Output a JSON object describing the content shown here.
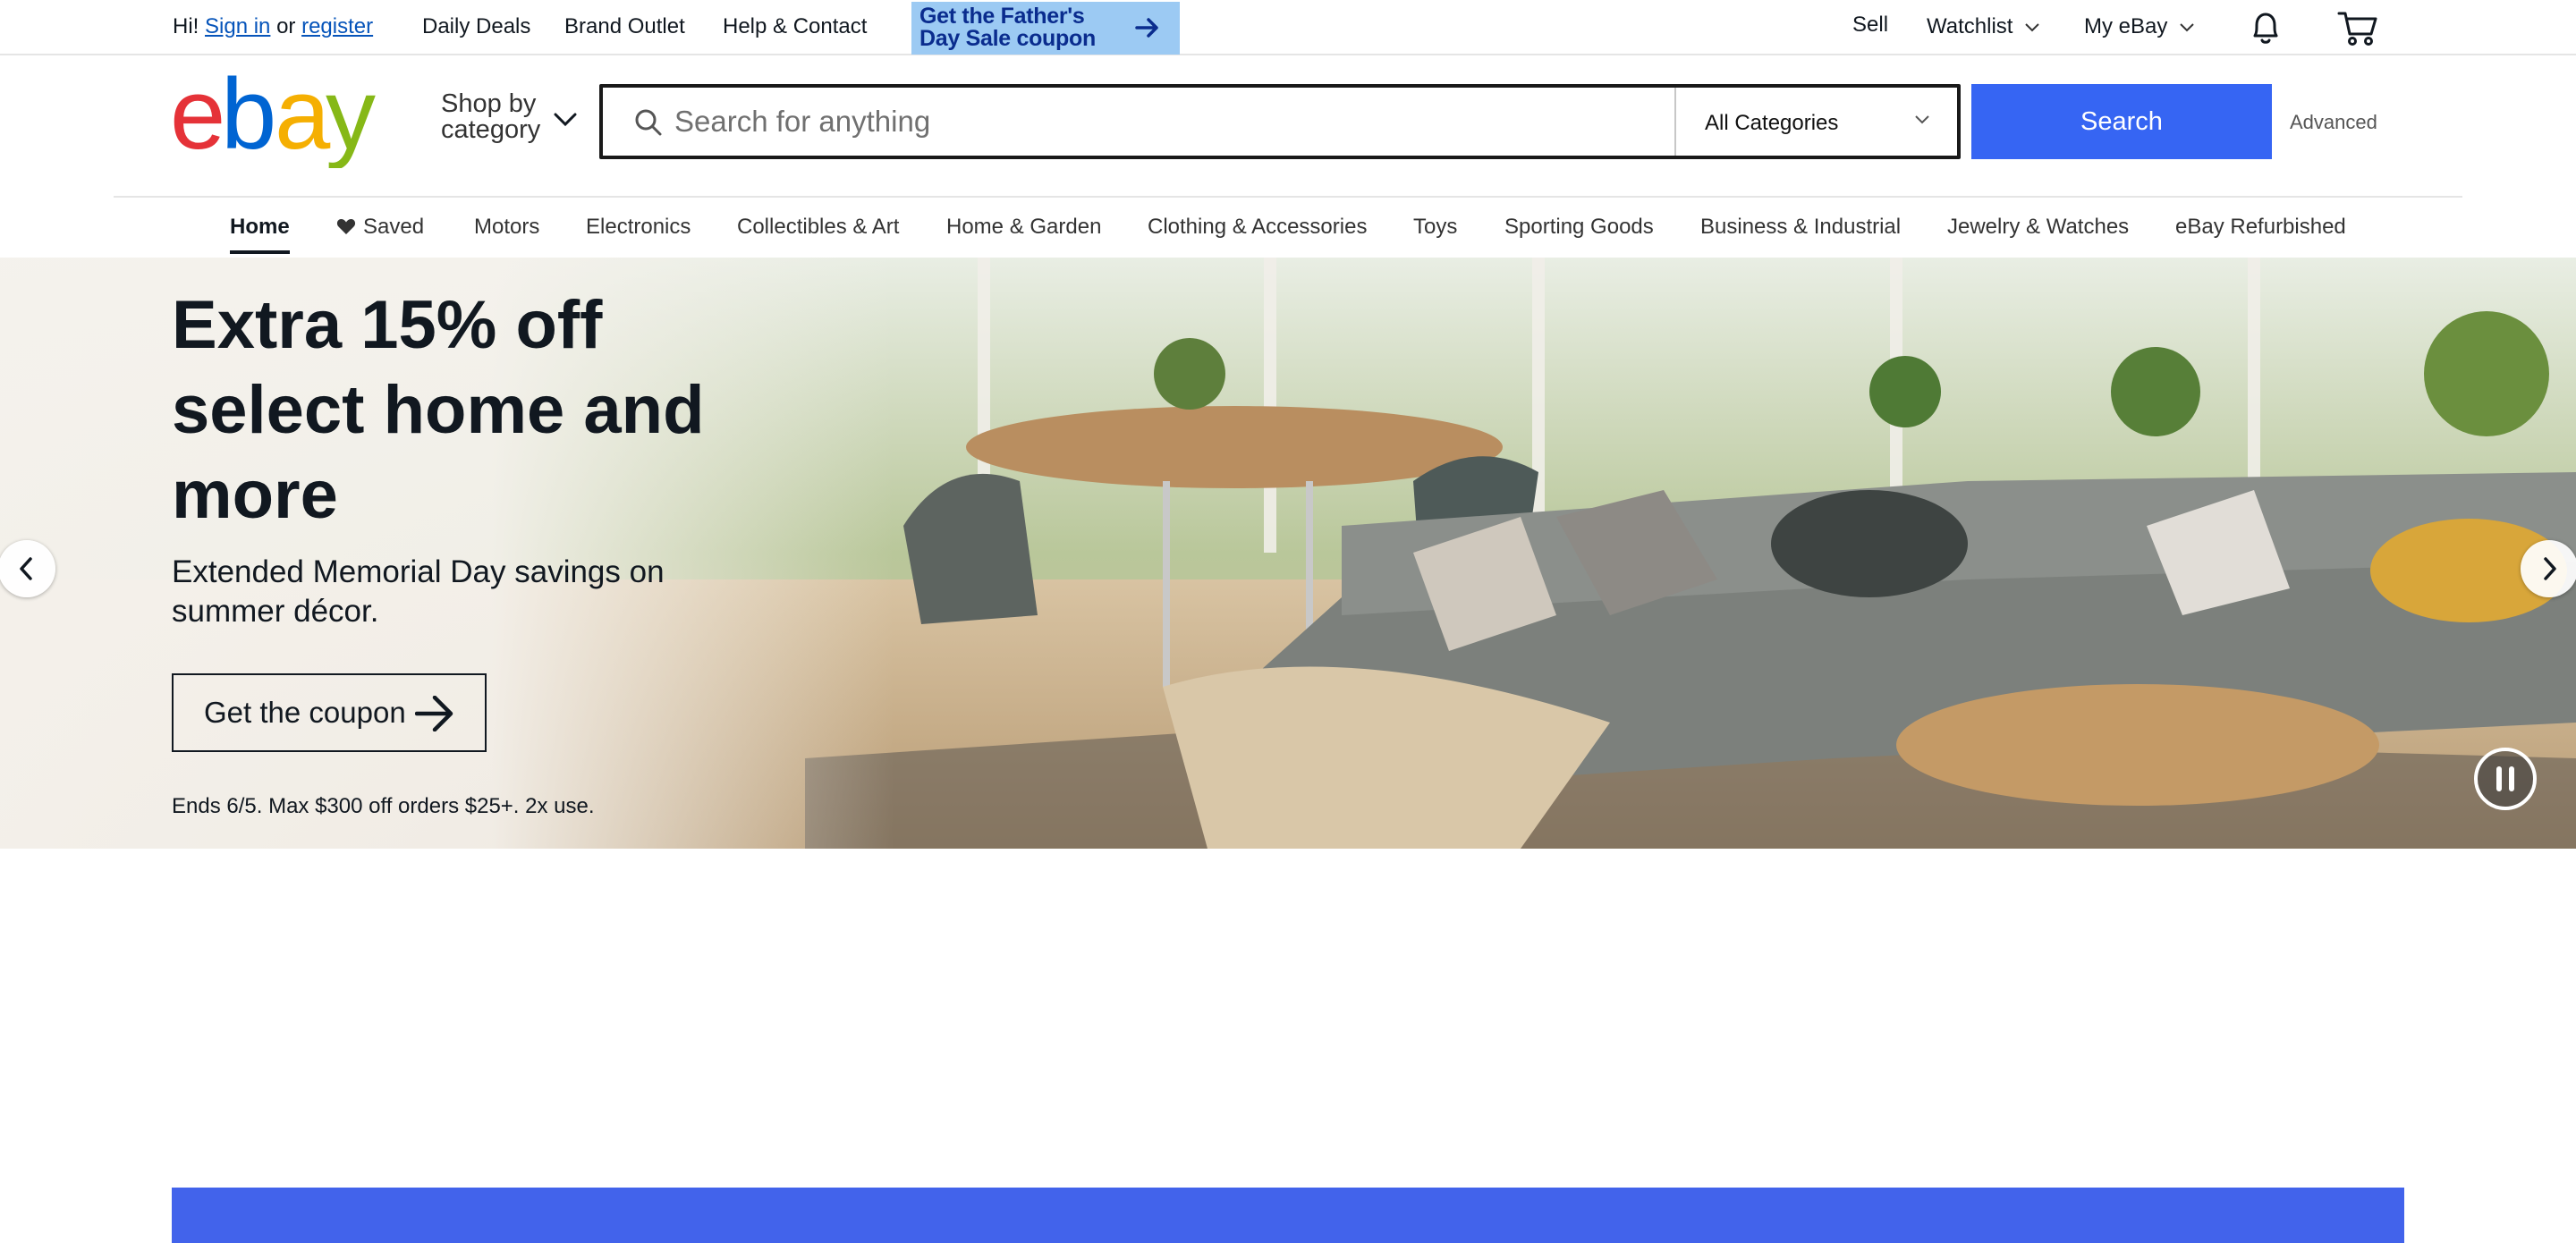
{
  "topbar": {
    "greeting": "Hi!",
    "sign_in": "Sign in",
    "or": "or",
    "register": "register",
    "daily_deals": "Daily Deals",
    "brand_outlet": "Brand Outlet",
    "help_contact": "Help & Contact",
    "promo_line1": "Get the Father's",
    "promo_line2": "Day Sale coupon",
    "sell": "Sell",
    "watchlist": "Watchlist",
    "my_ebay": "My eBay",
    "icons": [
      "chevron-down-icon",
      "bell-icon",
      "cart-icon"
    ]
  },
  "header": {
    "logo_letters": [
      "e",
      "b",
      "a",
      "y"
    ],
    "logo_colors": [
      "#e53238",
      "#0064d2",
      "#f5af02",
      "#86b817"
    ],
    "shop_by_line1": "Shop by",
    "shop_by_line2": "category",
    "search_placeholder": "Search for anything",
    "category_selected": "All Categories",
    "search_button": "Search",
    "advanced": "Advanced"
  },
  "nav": {
    "items": [
      "Home",
      "Saved",
      "Motors",
      "Electronics",
      "Collectibles & Art",
      "Home & Garden",
      "Clothing & Accessories",
      "Toys",
      "Sporting Goods",
      "Business & Industrial",
      "Jewelry & Watches",
      "eBay Refurbished"
    ],
    "active": "Home"
  },
  "hero": {
    "title": "Extra 15% off select home and more",
    "subtitle": "Extended Memorial Day savings on summer décor.",
    "cta": "Get the coupon",
    "fine_print": "Ends 6/5. Max $300 off orders $25+. 2x use."
  },
  "colors": {
    "accent": "#3665f3",
    "link": "#0654ba",
    "promo_bg": "#9ccaf3",
    "band": "#4263eb"
  }
}
